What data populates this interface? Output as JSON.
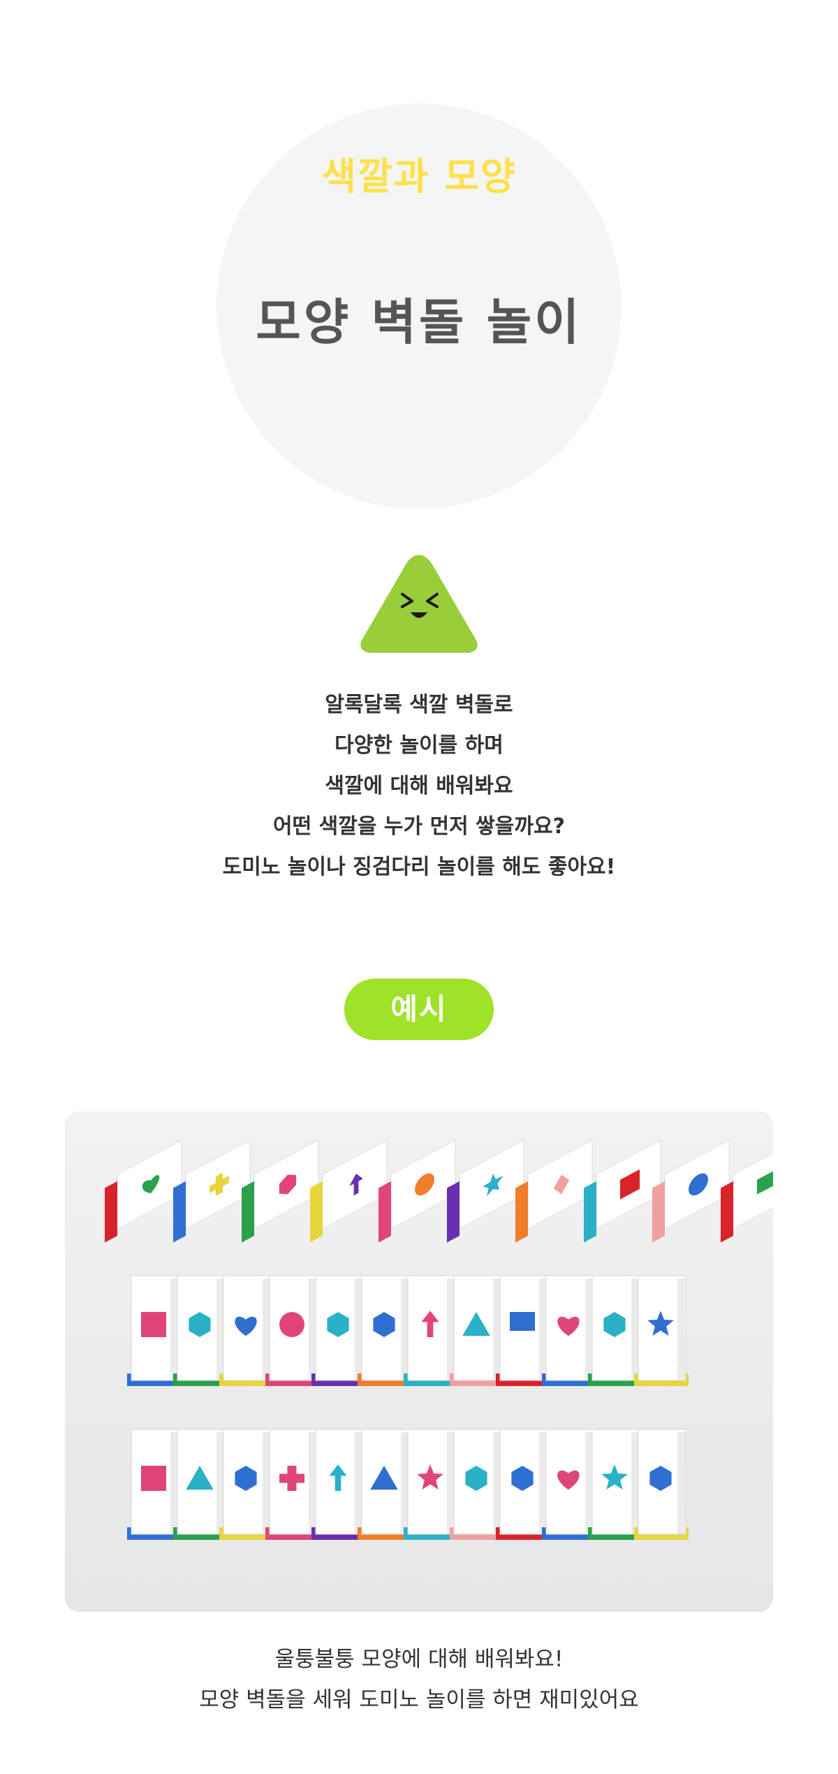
{
  "hero": {
    "subtitle": "색깔과 모양",
    "title": "모양 벽돌 놀이"
  },
  "mascot_icon": "smiling-green-triangle",
  "description": {
    "lines": [
      "알록달록 색깔 벽돌로",
      "다양한 놀이를 하며",
      "색깔에 대해 배워봐요",
      "어떤 색깔을 누가 먼저 쌓을까요?",
      "도미노 놀이나 징검다리 놀이를 해도 좋아요!"
    ]
  },
  "example": {
    "label": "예시"
  },
  "photo": {
    "subject": "shape-brick-domino-photo",
    "row1_shapes": [
      "heart",
      "cross",
      "hexagon",
      "arrow",
      "circle",
      "star",
      "diamond",
      "square",
      "circle",
      "rectangle"
    ],
    "row2_shapes": [
      "square",
      "hexagon",
      "heart",
      "circle",
      "hexagon",
      "hexagon",
      "arrow",
      "triangle",
      "rectangle",
      "heart",
      "hexagon",
      "star"
    ],
    "row3_shapes": [
      "square",
      "triangle",
      "hexagon",
      "cross",
      "arrow",
      "triangle",
      "star",
      "hexagon",
      "hexagon",
      "heart",
      "star",
      "hexagon"
    ]
  },
  "caption": {
    "lines": [
      "울퉁불퉁 모양에 대해 배워봐요!",
      "모양 벽돌을 세워 도미노 놀이를 하면 재미있어요"
    ]
  },
  "colors": {
    "hero_circle": "#f5f5f5",
    "hero_subtitle": "#fde14a",
    "hero_title": "#555555",
    "mascot": "#9acd3a",
    "example_pill": "#9ee22a",
    "brick_red": "#d8232a",
    "brick_blue": "#2f6fd1",
    "brick_green": "#2aa14a",
    "brick_yellow": "#e8d53a",
    "brick_pink": "#e0457a"
  }
}
